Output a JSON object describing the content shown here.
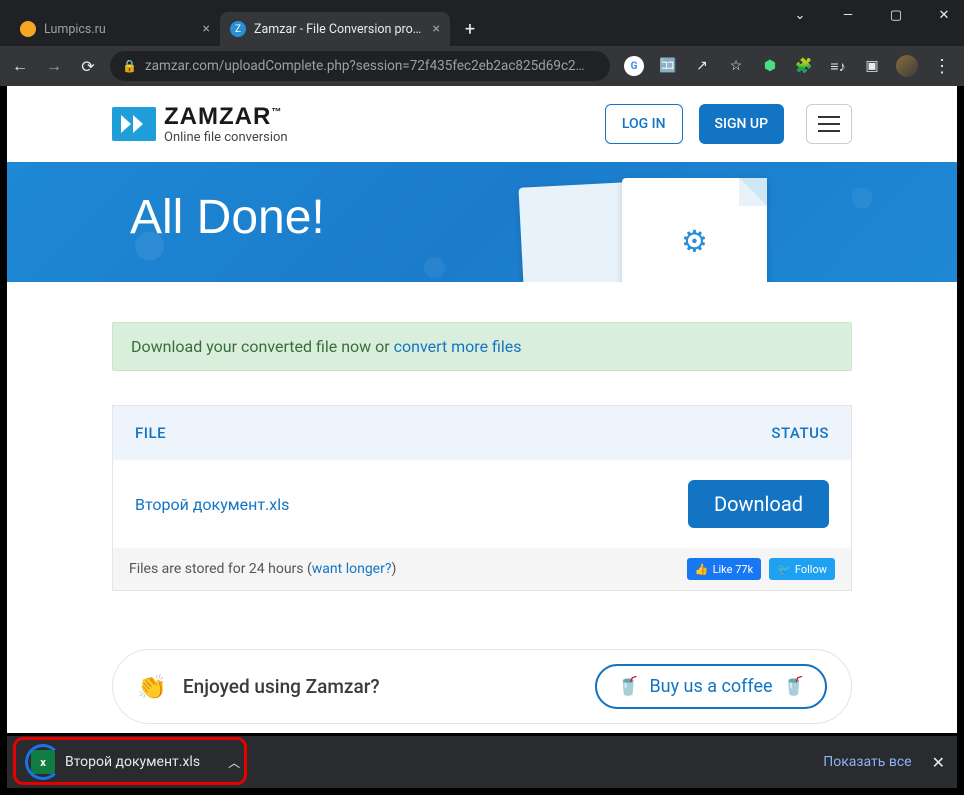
{
  "browser": {
    "tabs": [
      {
        "title": "Lumpics.ru",
        "active": false,
        "favicon_color": "#f5a623"
      },
      {
        "title": "Zamzar - File Conversion progres",
        "active": true,
        "favicon_color": "#2a8fd6"
      }
    ],
    "url": "zamzar.com/uploadComplete.php?session=72f435fec2eb2ac825d69c2…",
    "window_controls": {
      "min": "—",
      "max": "▢",
      "close": "✕"
    }
  },
  "site": {
    "brand": "ZAMZAR",
    "tagline": "Online file conversion",
    "login_label": "LOG IN",
    "signup_label": "SIGN UP"
  },
  "banner": {
    "heading": "All Done!"
  },
  "alert": {
    "prefix": "Download your converted file now or ",
    "link": "convert more files"
  },
  "panel": {
    "col_file": "FILE",
    "col_status": "STATUS",
    "file_name": "Второй документ.xls",
    "download_label": "Download",
    "footer_prefix": "Files are stored for 24 hours (",
    "footer_link": "want longer?",
    "footer_suffix": ")"
  },
  "social": {
    "fb_like": "Like 77k",
    "tw_follow": "Follow"
  },
  "coffee": {
    "prompt": "Enjoyed using Zamzar?",
    "button": "Buy us a coffee"
  },
  "download_bar": {
    "file": "Второй документ.xls",
    "show_all": "Показать все"
  }
}
